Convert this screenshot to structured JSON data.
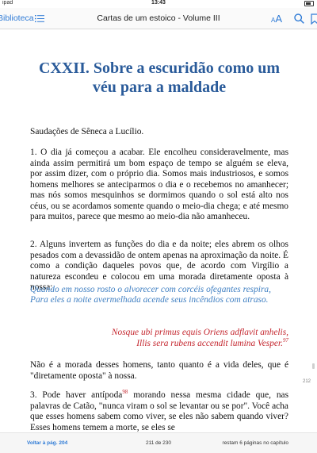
{
  "status": {
    "left": "ipad",
    "time": "13:43"
  },
  "toolbar": {
    "back_label": "Biblioteca",
    "title": "Cartas de um estoico - Volume III",
    "font_label_small": "A",
    "font_label_large": "A"
  },
  "chapter": {
    "title": "CXXII. Sobre a escuridão como um véu para a maldade",
    "greeting": "Saudações de Sêneca a Lucílio.",
    "paragraph1": "1. O dia já começou a acabar. Ele encolheu consideravelmente, mas ainda assim permitirá um bom espaço de tempo se alguém se eleva, por assim dizer, com o próprio dia. Somos mais industriosos, e somos homens melhores se antecipar­mos o dia e o recebemos no amanhecer; mas nós somos mesquinhos se dormimos quando o sol está alto nos céus, ou se acordamos somente quando o meio-dia chega; e até mesmo para muitos, parece que mesmo ao meio-dia não amanheceu.",
    "paragraph2": "2. Alguns invertem as funções do dia e da noite; eles abrem os olhos pesados com a devassidão de ontem apenas na aproximação da noite. É como a condição daqueles povos que, de acordo com Virgílio a natureza escondeu e colocou em uma morada diretamente oposta à nossa:",
    "quote_pt_1": "Quando em nosso rosto o alvorecer com corcéis ofegantes respira,",
    "quote_pt_2": "Para eles a noite avermelhada acende seus incêndios com atraso.",
    "quote_la_1": "Nosque ubi primus equis Oriens adflavit anhelis,",
    "quote_la_2": "Illis sera rubens accendit lumina Vesper.",
    "footnote_97": "97",
    "paragraph3": "Não é a morada desses homens, tanto quanto é a vida deles, que é \"diretamente oposta\" à nossa.",
    "paragraph4_a": "3. Pode haver antípoda",
    "footnote_98": "98",
    "paragraph4_b": " morando nessa mesma cidade que, nas palavras de Catão, \"nunca viram o sol se levantar ou se por\". Você acha que esses homens sabem como viver, se eles não sabem quando viver? Esses homens temem a morte, se eles se"
  },
  "side_page_number": "212",
  "bottom": {
    "back_page": "Voltar à pág. 204",
    "page_count": "211 de 230",
    "remaining": "restam 6 páginas no capítulo"
  },
  "colors": {
    "accent": "#2f7bd6",
    "title": "#2a5b9a",
    "quote_pt": "#3f7fc2",
    "quote_la": "#c4262e"
  }
}
